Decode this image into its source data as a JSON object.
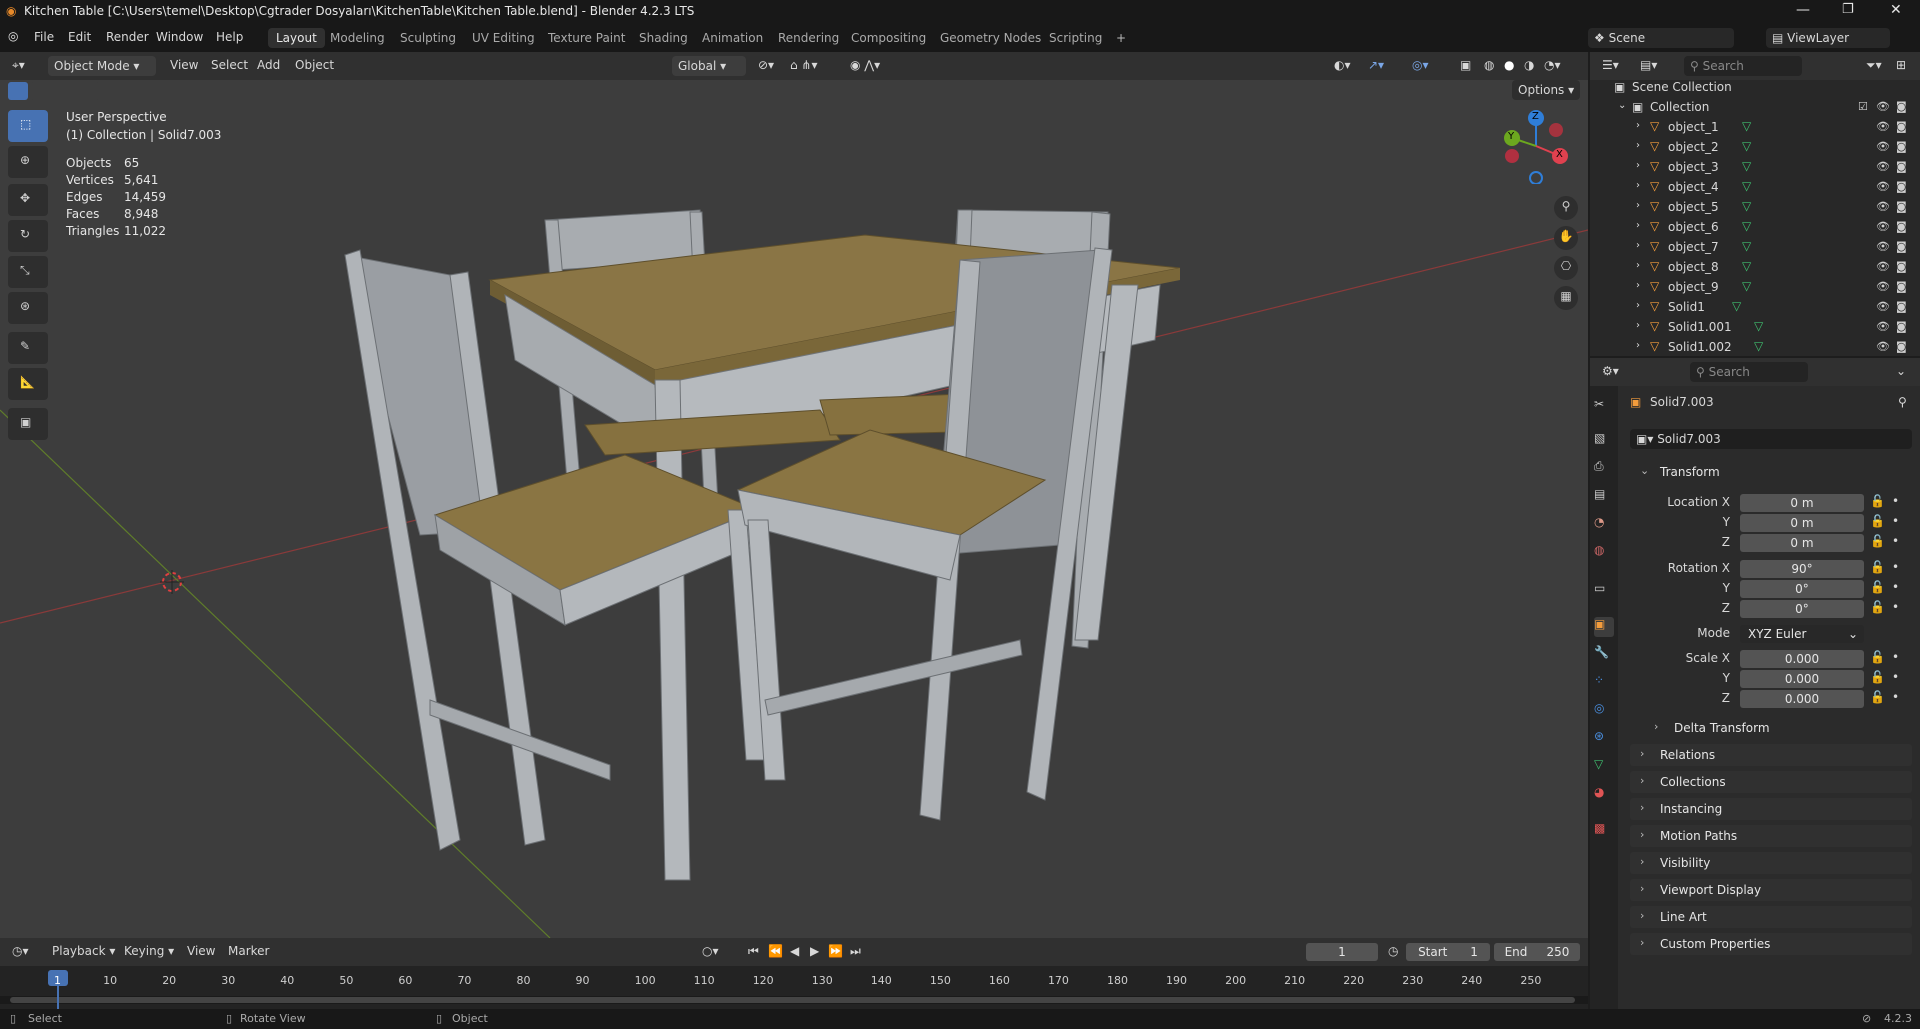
{
  "window": {
    "title": "Kitchen Table [C:\\Users\\temel\\Desktop\\Cgtrader Dosyaları\\KitchenTable\\Kitchen Table.blend] - Blender 4.2.3 LTS"
  },
  "menu": [
    "File",
    "Edit",
    "Render",
    "Window",
    "Help"
  ],
  "workspaces": [
    "Layout",
    "Modeling",
    "Sculpting",
    "UV Editing",
    "Texture Paint",
    "Shading",
    "Animation",
    "Rendering",
    "Compositing",
    "Geometry Nodes",
    "Scripting"
  ],
  "scene": {
    "label": "Scene",
    "view_layer": "ViewLayer"
  },
  "viewport_header": {
    "mode": "Object Mode",
    "view": "View",
    "select": "Select",
    "add": "Add",
    "object": "Object",
    "orientation": "Global",
    "options": "Options"
  },
  "overlay": {
    "view_name": "User Perspective",
    "collection_line": "(1) Collection | Solid7.003",
    "stats": [
      {
        "label": "Objects",
        "value": "65"
      },
      {
        "label": "Vertices",
        "value": "5,641"
      },
      {
        "label": "Edges",
        "value": "14,459"
      },
      {
        "label": "Faces",
        "value": "8,948"
      },
      {
        "label": "Triangles",
        "value": "11,022"
      }
    ]
  },
  "gizmo": {
    "x": "X",
    "y": "Y",
    "z": "Z",
    "x_color": "#e0414f",
    "y_color": "#6ca81f",
    "z_color": "#2f7ed8"
  },
  "outliner": {
    "search_placeholder": "Search",
    "root": "Scene Collection",
    "collection": "Collection",
    "items": [
      "object_1",
      "object_2",
      "object_3",
      "object_4",
      "object_5",
      "object_6",
      "object_7",
      "object_8",
      "object_9",
      "Solid1",
      "Solid1.001",
      "Solid1.002"
    ]
  },
  "properties": {
    "search_placeholder": "Search",
    "object_name": "Solid7.003",
    "data_name": "Solid7.003",
    "transform": {
      "title": "Transform",
      "location": [
        {
          "label": "Location X",
          "value": "0 m"
        },
        {
          "label": "Y",
          "value": "0 m"
        },
        {
          "label": "Z",
          "value": "0 m"
        }
      ],
      "rotation": [
        {
          "label": "Rotation X",
          "value": "90°"
        },
        {
          "label": "Y",
          "value": "0°"
        },
        {
          "label": "Z",
          "value": "0°"
        }
      ],
      "mode_label": "Mode",
      "mode_value": "XYZ Euler",
      "scale": [
        {
          "label": "Scale X",
          "value": "0.000"
        },
        {
          "label": "Y",
          "value": "0.000"
        },
        {
          "label": "Z",
          "value": "0.000"
        }
      ],
      "delta": "Delta Transform"
    },
    "panels": [
      "Relations",
      "Collections",
      "Instancing",
      "Motion Paths",
      "Visibility",
      "Viewport Display",
      "Line Art",
      "Custom Properties"
    ]
  },
  "timeline": {
    "playback": "Playback",
    "keying": "Keying",
    "view": "View",
    "marker": "Marker",
    "current_frame": "1",
    "start_label": "Start",
    "start": "1",
    "end_label": "End",
    "end": "250",
    "ticks": [
      "1",
      "10",
      "20",
      "30",
      "40",
      "50",
      "60",
      "70",
      "80",
      "90",
      "100",
      "110",
      "120",
      "130",
      "140",
      "150",
      "160",
      "170",
      "180",
      "190",
      "200",
      "210",
      "220",
      "230",
      "240",
      "250"
    ]
  },
  "statusbar": {
    "select": "Select",
    "rotate": "Rotate View",
    "object": "Object",
    "version": "4.2.3"
  },
  "colors": {
    "accent": "#4772b3",
    "wood": "#7d6a3e",
    "chair": "#a8acb0"
  }
}
